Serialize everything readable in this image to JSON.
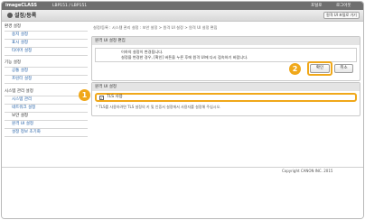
{
  "header": {
    "brand": "imageCLASS",
    "model": "LBP151 / LBP151",
    "links": [
      "포털로",
      "로그아웃"
    ],
    "title": "설정/등록",
    "portal_button": "원격 UI 포털로 가기"
  },
  "sidebar": {
    "sections": [
      {
        "label": "환경 설정",
        "items": [
          "용지 설정",
          "표시 설정",
          "타이머 설정"
        ]
      },
      {
        "label": "기능 설정",
        "items": [
          "공통 설정",
          "프린터 설정"
        ]
      },
      {
        "label": "시스템 관리 설정",
        "items": [
          "시스템 관리",
          "네트워크 설정",
          "보안 설정",
          "원격 UI 설정",
          "설정 정보 초기화"
        ]
      }
    ],
    "active_item": "보안 설정"
  },
  "breadcrumb": "설정/등록 : 시스템 관리 설정 : 보안 설정 > 원격 UI 설정 > 원격 UI 설정 편집",
  "edit_panel": {
    "title": "원격 UI 설정 편집",
    "message_lines": [
      "이하의 설정이 변경됩니다.",
      "설정을 변경한 경우, [확인] 버튼을 누른 후에 원격 UI에 다시 접속하기 바랍니다."
    ],
    "ok_label": "확인",
    "cancel_label": "취소"
  },
  "remote_ui_panel": {
    "title": "원격 UI 설정",
    "tls_label": "TLS 사용",
    "tls_checked": true,
    "note": "* TLS를 사용하려면 TLS 설정의 키 및 인증서 설정에서 사용자를 설정해 주십시오."
  },
  "callouts": [
    "1",
    "2"
  ],
  "footer": {
    "copyright": "Copyright CANON INC. 2015"
  },
  "colors": {
    "accent": "#f0a81a",
    "header": "#6f6f6f",
    "link": "#1e5ca5"
  }
}
